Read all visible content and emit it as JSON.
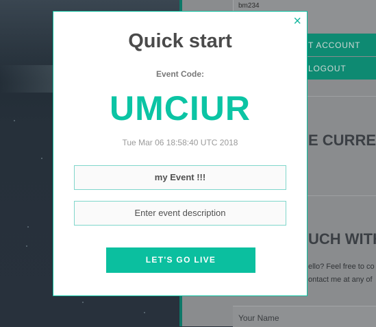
{
  "background": {
    "username": "bm234",
    "buttons": [
      "T ACCOUNT",
      "LOGOUT"
    ],
    "heading1": "E CURRE",
    "heading2": "UCH WITH",
    "para_line1": "ello? Feel free to co",
    "para_line2": "ontact me at any of",
    "name_placeholder": "Your Name"
  },
  "modal": {
    "close_icon": "×",
    "title": "Quick start",
    "code_label": "Event Code:",
    "event_code": "UMCIUR",
    "timestamp": "Tue Mar 06 18:58:40 UTC 2018",
    "name_value": "my Event !!!",
    "description_placeholder": "Enter event description",
    "go_button": "LET'S GO LIVE"
  },
  "colors": {
    "accent": "#0bbf9f",
    "title": "#4a4a4a"
  }
}
